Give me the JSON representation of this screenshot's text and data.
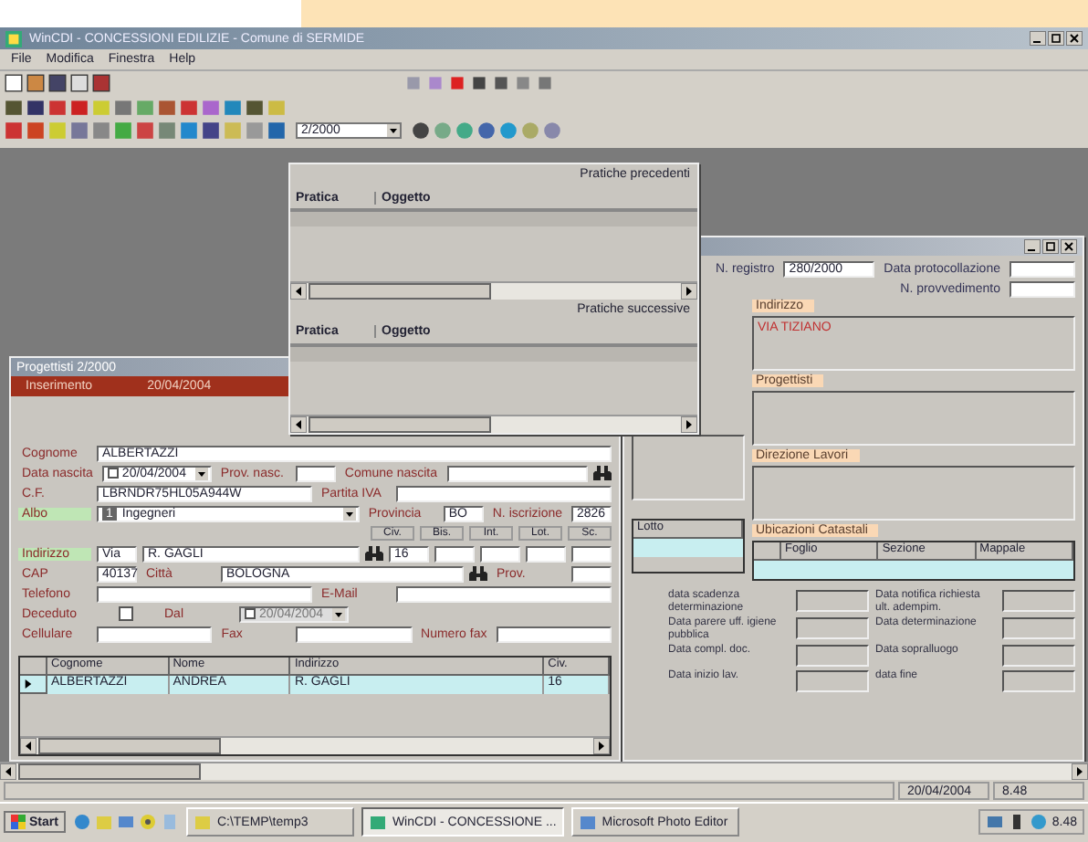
{
  "window": {
    "title": "WinCDI - CONCESSIONI EDILIZIE - Comune di SERMIDE"
  },
  "menu": [
    "File",
    "Modifica",
    "Finestra",
    "Help"
  ],
  "toolbar": {
    "combo": "2/2000"
  },
  "related_window": {
    "sections": [
      {
        "title": "Pratiche precedenti",
        "columns": [
          "Pratica",
          "Oggetto"
        ]
      },
      {
        "title": "Pratiche successive",
        "columns": [
          "Pratica",
          "Oggetto"
        ]
      }
    ]
  },
  "detail_window": {
    "top_rows": [
      {
        "items": [
          {
            "kind": "label",
            "text": "N. registro",
            "highlighted": false
          },
          {
            "kind": "input",
            "value": "280/2000"
          },
          {
            "kind": "label",
            "text": "Data protocollazione",
            "highlighted": false
          },
          {
            "kind": "small"
          }
        ]
      },
      {
        "items": [
          {
            "kind": "spacer"
          },
          {
            "kind": "label",
            "text": "N. provvedimento",
            "highlighted": false
          },
          {
            "kind": "small"
          }
        ]
      }
    ],
    "memos": [
      {
        "label": "Indirizzo",
        "value": "VIA TIZIANO"
      },
      {
        "label": "Progettisti"
      },
      {
        "label": "Direzione Lavori"
      }
    ],
    "lot_grid": {
      "columns": [
        "Lotto"
      ]
    },
    "parcel_grid": {
      "label": "Ubicazioni Catastali",
      "columns": [
        "Foglio",
        "Sezione",
        "Mappale"
      ]
    },
    "dates": [
      {
        "label": "data scadenza determinazione"
      },
      {
        "label": "Data notifica richiesta ult. adempim."
      },
      {
        "label": "Data parere uff. igiene pubblica"
      },
      {
        "label": "Data determinazione"
      },
      {
        "label": "Data compl. doc."
      },
      {
        "label": "Data sopralluogo"
      },
      {
        "label": "Data inizio lav."
      },
      {
        "label": "data fine"
      }
    ]
  },
  "form_window": {
    "title": "Progettisti 2/2000",
    "mode": "Inserimento",
    "date": "20/04/2004",
    "rows": [
      {
        "items": [
          {
            "kind": "label",
            "text": "Cognome",
            "highlighted": false
          },
          {
            "kind": "input",
            "value": "ALBERTAZZI"
          }
        ]
      },
      {
        "items": [
          {
            "kind": "label",
            "text": "Data nascita",
            "highlighted": false
          },
          {
            "kind": "date",
            "value": "20/04/2004",
            "checked": false,
            "disabled": false
          },
          {
            "kind": "label",
            "text": "Prov. nasc.",
            "highlighted": false
          },
          {
            "kind": "small",
            "value": ""
          },
          {
            "kind": "label",
            "text": "Comune nascita",
            "highlighted": false
          },
          {
            "kind": "input"
          },
          {
            "kind": "search"
          }
        ]
      },
      {
        "items": [
          {
            "kind": "label",
            "text": "C.F.",
            "highlighted": false
          },
          {
            "kind": "input",
            "value": "LBRNDR75HL05A944W"
          },
          {
            "kind": "label",
            "text": "Partita IVA",
            "highlighted": false
          },
          {
            "kind": "input"
          }
        ]
      },
      {
        "items": [
          {
            "kind": "label",
            "text": "Albo",
            "highlighted": true
          },
          {
            "kind": "combo",
            "code": "1",
            "value": "Ingegneri"
          },
          {
            "kind": "label",
            "text": "Provincia",
            "highlighted": false
          },
          {
            "kind": "small",
            "value": "BO"
          },
          {
            "kind": "label",
            "text": "N. iscrizione",
            "highlighted": false
          },
          {
            "kind": "small",
            "value": "2826"
          }
        ]
      },
      {
        "items": [
          {
            "kind": "spacer"
          },
          {
            "kind": "head",
            "text": "Civ."
          },
          {
            "kind": "head",
            "text": "Bis."
          },
          {
            "kind": "head",
            "text": "Int."
          },
          {
            "kind": "head",
            "text": "Lot."
          },
          {
            "kind": "head",
            "text": "Sc."
          }
        ]
      },
      {
        "items": [
          {
            "kind": "label",
            "text": "Indirizzo",
            "highlighted": true
          },
          {
            "kind": "small",
            "value": "Via"
          },
          {
            "kind": "input",
            "value": "R. GAGLI"
          },
          {
            "kind": "search"
          },
          {
            "kind": "small",
            "value": "16"
          },
          {
            "kind": "small"
          },
          {
            "kind": "small"
          },
          {
            "kind": "small"
          },
          {
            "kind": "small"
          }
        ]
      },
      {
        "items": [
          {
            "kind": "label",
            "text": "CAP",
            "highlighted": false
          },
          {
            "kind": "small",
            "value": "40137"
          },
          {
            "kind": "label",
            "text": "Città",
            "highlighted": false
          },
          {
            "kind": "input",
            "value": "BOLOGNA"
          },
          {
            "kind": "search"
          },
          {
            "kind": "label",
            "text": "Prov.",
            "highlighted": false
          },
          {
            "kind": "small"
          }
        ]
      },
      {
        "items": [
          {
            "kind": "label",
            "text": "Telefono",
            "highlighted": false
          },
          {
            "kind": "input"
          },
          {
            "kind": "label",
            "text": "E-Mail",
            "highlighted": false
          },
          {
            "kind": "input"
          }
        ]
      },
      {
        "items": [
          {
            "kind": "label",
            "text": "Deceduto",
            "highlighted": false
          },
          {
            "kind": "check",
            "checked": false
          },
          {
            "kind": "label",
            "text": "Dal",
            "highlighted": false
          },
          {
            "kind": "date",
            "value": "20/04/2004",
            "checked": false,
            "disabled": true
          }
        ]
      },
      {
        "items": [
          {
            "kind": "label",
            "text": "Cellulare",
            "highlighted": false
          },
          {
            "kind": "input"
          },
          {
            "kind": "label",
            "text": "Fax",
            "highlighted": false
          },
          {
            "kind": "input"
          },
          {
            "kind": "label",
            "text": "Numero fax",
            "highlighted": false
          },
          {
            "kind": "input"
          }
        ]
      }
    ],
    "grid": {
      "columns": [
        "Cognome",
        "Nome",
        "Indirizzo",
        "Civ."
      ],
      "rows": [
        {
          "cells": [
            "ALBERTAZZI",
            "ANDREA",
            "R. GAGLI",
            "16"
          ],
          "selected": true
        }
      ]
    }
  },
  "status_bar": {
    "date": "20/04/2004",
    "time": "8.48"
  },
  "taskbar": {
    "start": "Start",
    "tasks": [
      {
        "label": "C:\\TEMP\\temp3",
        "selected": false
      },
      {
        "label": "WinCDI - CONCESSIONE ...",
        "selected": true
      },
      {
        "label": "Microsoft Photo Editor",
        "selected": false
      }
    ],
    "clock": "8.48"
  }
}
